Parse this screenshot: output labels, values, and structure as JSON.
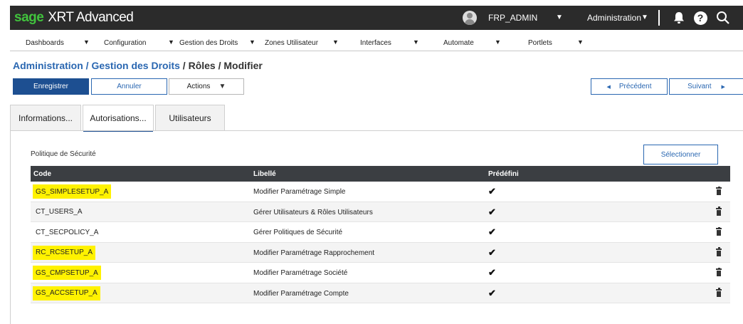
{
  "topbar": {
    "brand": "sage",
    "product": "XRT Advanced",
    "user": "FRP_ADMIN",
    "admin_menu": "Administration",
    "icons": [
      "avatar-icon",
      "bell-icon",
      "help-icon",
      "search-icon"
    ]
  },
  "menu": {
    "items": [
      {
        "label": "Dashboards"
      },
      {
        "label": "Configuration"
      },
      {
        "label": "Gestion des Droits"
      },
      {
        "label": "Zones Utilisateur"
      },
      {
        "label": "Interfaces"
      },
      {
        "label": "Automate"
      },
      {
        "label": "Portlets"
      }
    ]
  },
  "breadcrumb": {
    "part1": "Administration",
    "sep1": " / ",
    "part2": "Gestion des Droits",
    "rest": " / Rôles / Modifier"
  },
  "actions": {
    "save": "Enregistrer",
    "cancel": "Annuler",
    "actions": "Actions",
    "previous": "Précédent",
    "next": "Suivant"
  },
  "tabs": [
    {
      "label": "Informations...",
      "active": false
    },
    {
      "label": "Autorisations...",
      "active": true
    },
    {
      "label": "Utilisateurs",
      "active": false
    }
  ],
  "section": {
    "title": "Politique de Sécurité",
    "select_label": "Sélectionner"
  },
  "table": {
    "columns": [
      "Code",
      "Libellé",
      "Prédéfini"
    ],
    "rows": [
      {
        "code": "GS_SIMPLESETUP_A",
        "libelle": "Modifier Paramétrage Simple",
        "predefini": "✔",
        "highlighted": true
      },
      {
        "code": "CT_USERS_A",
        "libelle": "Gérer Utilisateurs & Rôles Utilisateurs",
        "predefini": "✔",
        "highlighted": false
      },
      {
        "code": "CT_SECPOLICY_A",
        "libelle": "Gérer Politiques de Sécurité",
        "predefini": "✔",
        "highlighted": false
      },
      {
        "code": "RC_RCSETUP_A",
        "libelle": "Modifier Paramétrage Rapprochement",
        "predefini": "✔",
        "highlighted": true
      },
      {
        "code": "GS_CMPSETUP_A",
        "libelle": "Modifier Paramétrage Société",
        "predefini": "✔",
        "highlighted": true
      },
      {
        "code": "GS_ACCSETUP_A",
        "libelle": "Modifier Paramétrage Compte",
        "predefini": "✔",
        "highlighted": true
      }
    ]
  },
  "colors": {
    "brand_green": "#41c33d",
    "topbar_bg": "#2b2b2b",
    "primary_blue": "#1d4f91",
    "link_blue": "#2a67b1",
    "highlight_yellow": "#fff200",
    "table_header_bg": "#3b3e42"
  }
}
